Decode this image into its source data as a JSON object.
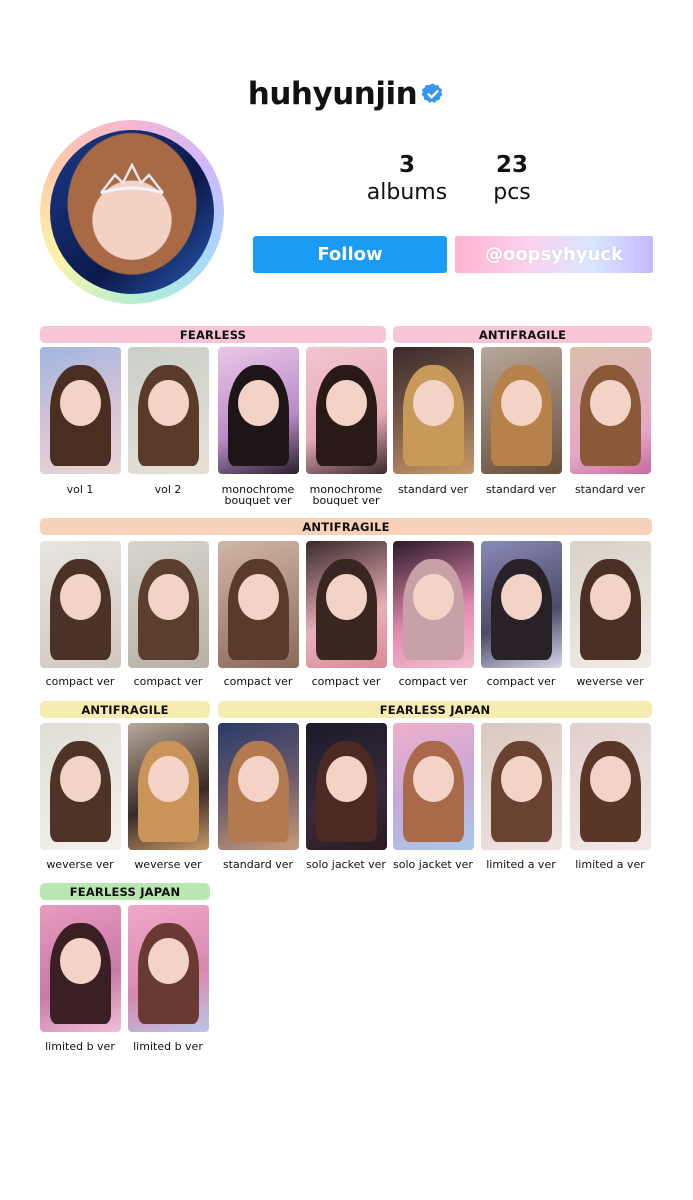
{
  "profile": {
    "username": "huhyunjin",
    "verified_icon": "verified-badge-icon",
    "albums_count": "3",
    "albums_label": "albums",
    "pcs_count": "23",
    "pcs_label": "pcs",
    "follow_label": "Follow",
    "handle_label": "@oopsyhyuck",
    "colors": {
      "follow": "#1a9cf5",
      "verified": "#3797f0"
    }
  },
  "sections": [
    {
      "label": "FEARLESS",
      "color": "#f6c6d8"
    },
    {
      "label": "ANTIFRAGILE",
      "color": "#f6c6d8"
    },
    {
      "label": "ANTIFRAGILE",
      "color": "#f8d2b8"
    },
    {
      "label": "ANTIFRAGILE",
      "color": "#f7ecb0"
    },
    {
      "label": "FEARLESS JAPAN",
      "color": "#f7ecb0"
    },
    {
      "label": "FEARLESS JAPAN",
      "color": "#b9e6b1"
    }
  ],
  "cards": [
    {
      "caption": "vol 1"
    },
    {
      "caption": "vol 2"
    },
    {
      "caption": "monochrome bouquet ver"
    },
    {
      "caption": "monochrome bouquet ver"
    },
    {
      "caption": "standard ver"
    },
    {
      "caption": "standard ver"
    },
    {
      "caption": "standard ver"
    },
    {
      "caption": "compact ver"
    },
    {
      "caption": "compact ver"
    },
    {
      "caption": "compact ver"
    },
    {
      "caption": "compact ver"
    },
    {
      "caption": "compact ver"
    },
    {
      "caption": "compact ver"
    },
    {
      "caption": "weverse ver"
    },
    {
      "caption": "weverse ver"
    },
    {
      "caption": "weverse ver"
    },
    {
      "caption": "standard ver"
    },
    {
      "caption": "solo jacket ver"
    },
    {
      "caption": "solo jacket ver"
    },
    {
      "caption": "limited a ver"
    },
    {
      "caption": "limited a ver"
    },
    {
      "caption": "limited b ver"
    },
    {
      "caption": "limited b ver"
    }
  ]
}
